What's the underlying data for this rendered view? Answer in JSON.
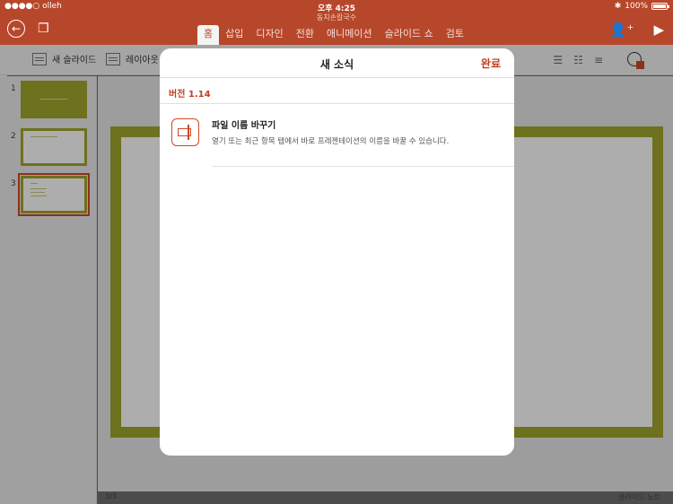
{
  "status": {
    "carrier": "●●●●○ olleh",
    "time": "오후 4:25",
    "battery": "100%"
  },
  "document": {
    "title": "동치손칼국수"
  },
  "ribbon": {
    "tabs": [
      "홈",
      "삽입",
      "디자인",
      "전환",
      "애니메이션",
      "슬라이드 쇼",
      "검토"
    ]
  },
  "toolbar": {
    "new_slide_label": "새 슬라이드",
    "layout_label": "레이아웃"
  },
  "slides": {
    "numbers": [
      "1",
      "2",
      "3"
    ]
  },
  "footer": {
    "slide_count": "3/3",
    "notes_label": "슬라이드 노트"
  },
  "modal": {
    "title": "새 소식",
    "done_label": "완료",
    "version": "버전 1.14",
    "feature_title": "파일 이름 바꾸기",
    "feature_desc": "열기 또는 최근 항목 탭에서 바로 프레젠테이션의 이름을 바꿀 수 있습니다."
  },
  "colors": {
    "accent": "#b7472a",
    "highlight": "#c43e1c",
    "slide_theme": "#a3a72b"
  }
}
